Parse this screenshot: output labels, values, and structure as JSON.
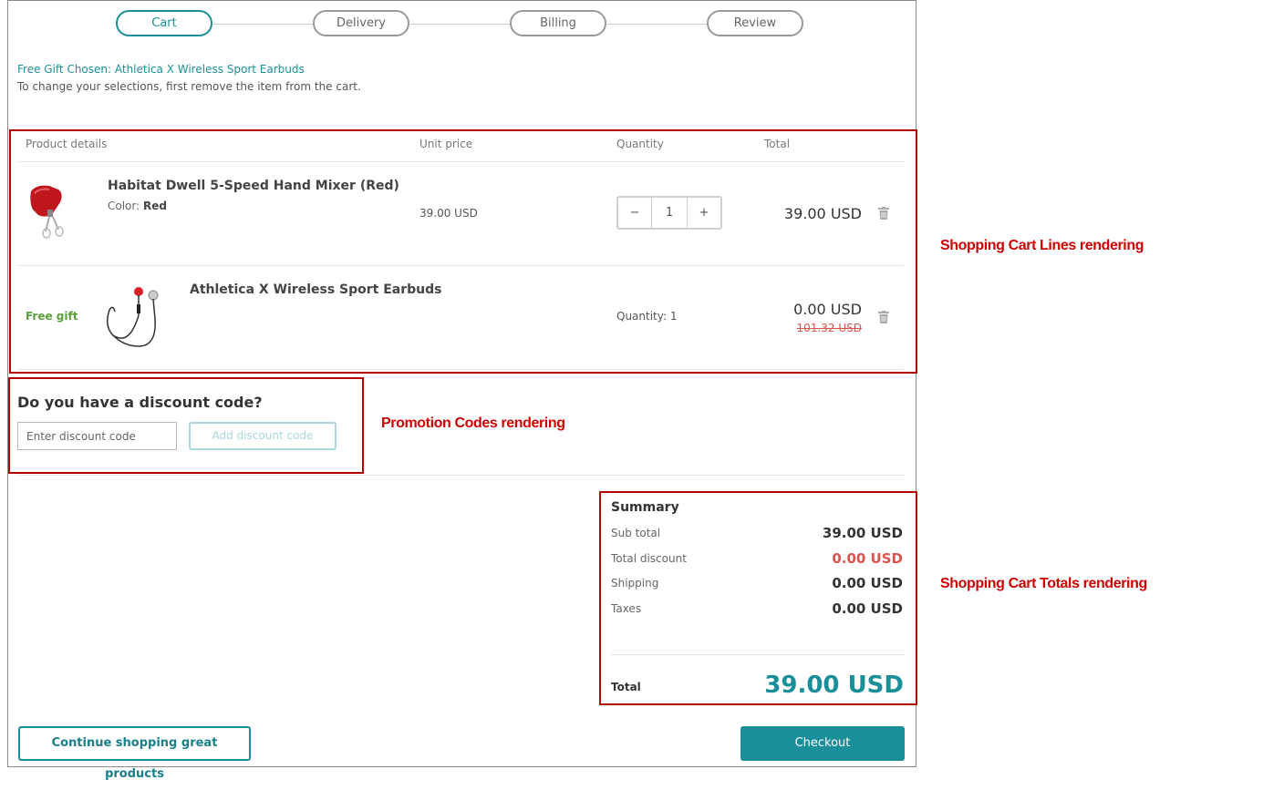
{
  "steps": [
    "Cart",
    "Delivery",
    "Billing",
    "Review"
  ],
  "notice": {
    "gift_chosen": "Free Gift Chosen: Athletica X Wireless Sport Earbuds",
    "instruction": "To change your selections, first remove the item from the cart."
  },
  "table_headers": {
    "product": "Product details",
    "unit_price": "Unit price",
    "quantity": "Quantity",
    "total": "Total"
  },
  "items": [
    {
      "name": "Habitat Dwell 5-Speed Hand Mixer (Red)",
      "attr_label": "Color:",
      "attr_value": "Red",
      "unit_price": "39.00 USD",
      "quantity": "1",
      "qty_minus": "−",
      "qty_plus": "+",
      "total": "39.00 USD"
    },
    {
      "badge": "Free gift",
      "name": "Athletica X Wireless Sport Earbuds",
      "quantity_text": "Quantity: 1",
      "total": "0.00 USD",
      "original_total": "101.32 USD"
    }
  ],
  "discount": {
    "title": "Do you have a discount code?",
    "placeholder": "Enter discount code",
    "button": "Add discount code"
  },
  "summary": {
    "title": "Summary",
    "rows": [
      {
        "label": "Sub total",
        "value": "39.00 USD"
      },
      {
        "label": "Total discount",
        "value": "0.00 USD"
      },
      {
        "label": "Shipping",
        "value": "0.00 USD"
      },
      {
        "label": "Taxes",
        "value": "0.00 USD"
      }
    ],
    "total_label": "Total",
    "total_value": "39.00 USD"
  },
  "actions": {
    "continue": "Continue shopping great products",
    "checkout": "Checkout"
  },
  "annotations": {
    "lines": "Shopping Cart Lines rendering",
    "promo": "Promotion Codes rendering",
    "totals": "Shopping Cart Totals rendering"
  },
  "colors": {
    "accent": "#1a8f99",
    "annotation": "#cc0000",
    "free_gift": "#5b9f3c",
    "discount": "#d9534f"
  }
}
